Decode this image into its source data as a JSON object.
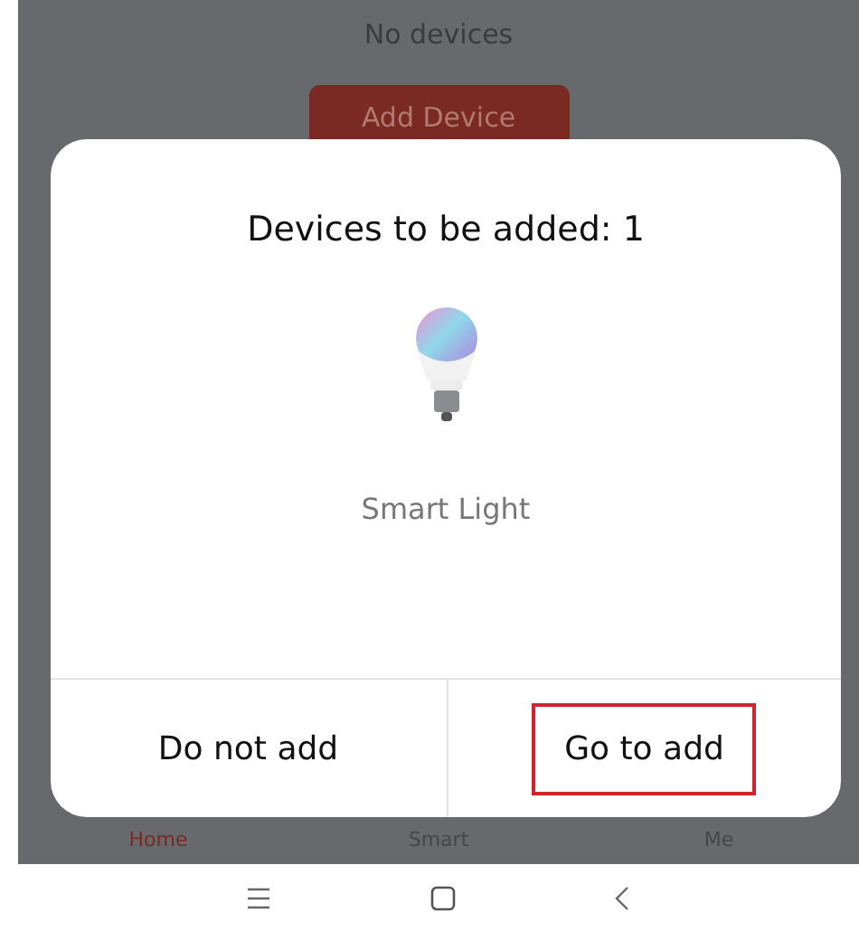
{
  "background": {
    "message": "No devices",
    "button": "Add Device"
  },
  "dialog": {
    "title": "Devices to be added: 1",
    "device": {
      "name": "Smart Light"
    },
    "buttons": [
      {
        "label": "Do not add",
        "highlighted": false
      },
      {
        "label": "Go to add",
        "highlighted": true
      }
    ]
  },
  "tab_bar": [
    {
      "label": "Home",
      "selected": true
    },
    {
      "label": "Smart",
      "selected": false
    },
    {
      "label": "Me",
      "selected": false
    }
  ]
}
